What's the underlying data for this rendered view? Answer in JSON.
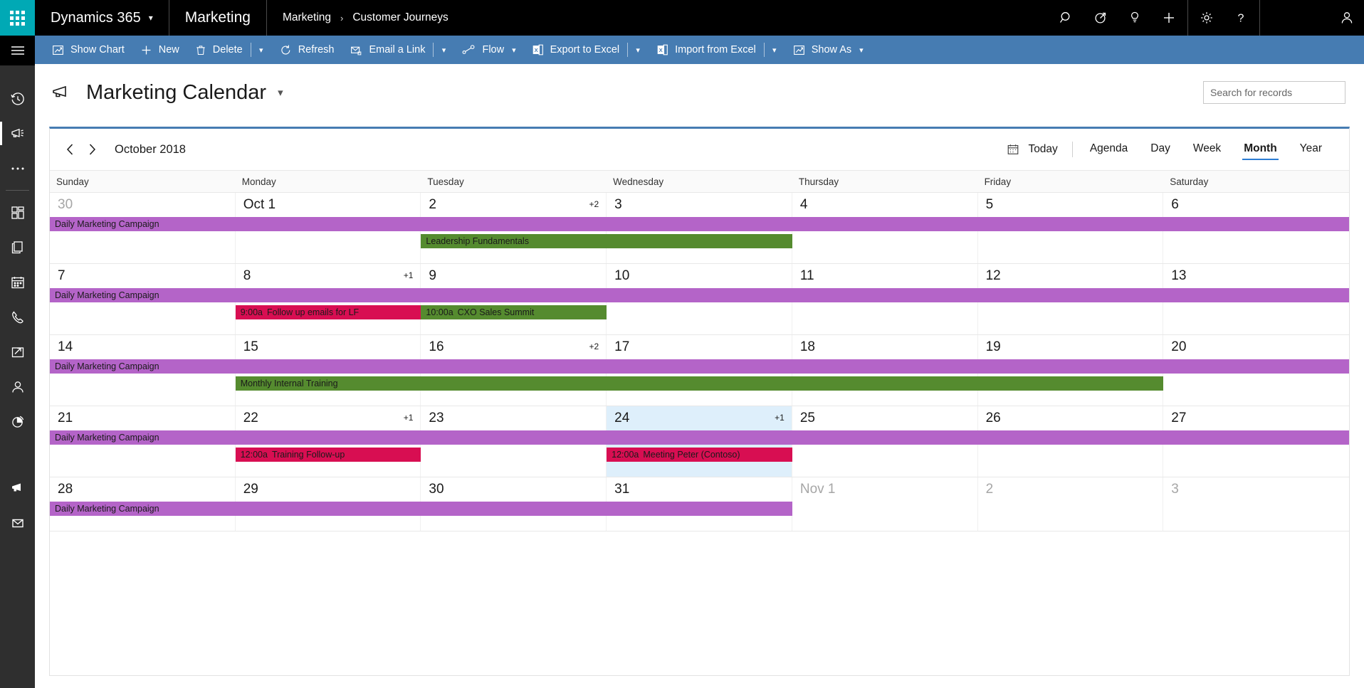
{
  "topbar": {
    "waffle_label": "app-launcher",
    "brand": "Dynamics 365",
    "app_name": "Marketing",
    "breadcrumb": {
      "parent": "Marketing",
      "separator": "›",
      "current": "Customer Journeys"
    },
    "icons": [
      "search-icon",
      "assistant-icon",
      "insights-icon",
      "quick-create-icon",
      "settings-icon",
      "help-icon",
      "user-avatar-icon"
    ]
  },
  "commandbar": {
    "items": [
      {
        "label": "Show Chart",
        "icon": "show-chart-icon",
        "caret": false
      },
      {
        "label": "New",
        "icon": "plus-icon",
        "caret": false
      },
      {
        "label": "Delete",
        "icon": "trash-icon",
        "caret": true,
        "caret_glyph": "⌄"
      },
      {
        "label": "Refresh",
        "icon": "refresh-icon",
        "caret": false
      },
      {
        "label": "Email a Link",
        "icon": "email-link-icon",
        "caret": true,
        "caret_glyph": "⌄"
      },
      {
        "label": "Flow",
        "icon": "flow-icon",
        "caret": true,
        "inline_caret": true,
        "caret_glyph": "⌄"
      },
      {
        "label": "Export to Excel",
        "icon": "excel-export-icon",
        "caret": true,
        "caret_glyph": "⌄"
      },
      {
        "label": "Import from Excel",
        "icon": "excel-import-icon",
        "caret": true,
        "caret_glyph": "⌄"
      },
      {
        "label": "Show As",
        "icon": "show-as-icon",
        "caret": true,
        "inline_caret": true,
        "caret_glyph": "⌄"
      }
    ]
  },
  "pageheader": {
    "icon": "megaphone-icon",
    "title": "Marketing Calendar",
    "chevron": "⌄",
    "search": {
      "placeholder": "Search for records",
      "value": "",
      "icon": "search-icon"
    }
  },
  "leftrail": {
    "items": [
      {
        "name": "menu-toggle",
        "icon": "hamburger-icon",
        "active": false
      },
      {
        "name": "recent-items",
        "icon": "recent-clock-icon",
        "active": false
      },
      {
        "name": "pinned-marketing",
        "icon": "megaphone-icon",
        "active": true
      },
      {
        "name": "more-options",
        "icon": "ellipsis-icon",
        "active": false
      },
      {
        "name": "dashboards",
        "icon": "dashboard-icon",
        "active": false
      },
      {
        "name": "documents",
        "icon": "documents-icon",
        "active": false
      },
      {
        "name": "calendar",
        "icon": "calendar-icon",
        "active": false
      },
      {
        "name": "phone-calls",
        "icon": "phone-icon",
        "active": false
      },
      {
        "name": "cases",
        "icon": "case-folder-icon",
        "active": false
      },
      {
        "name": "contacts",
        "icon": "person-icon",
        "active": false
      },
      {
        "name": "analytics",
        "icon": "pie-chart-icon",
        "active": false
      },
      {
        "name": "campaigns",
        "icon": "megaphone-icon",
        "active": false
      },
      {
        "name": "email-messages",
        "icon": "envelope-icon",
        "active": false
      }
    ]
  },
  "calendar": {
    "prev_label": "‹",
    "next_label": "›",
    "month_label": "October 2018",
    "today_button": {
      "label": "Today",
      "icon": "calendar-icon"
    },
    "views": [
      {
        "label": "Agenda",
        "selected": false
      },
      {
        "label": "Day",
        "selected": false
      },
      {
        "label": "Week",
        "selected": false
      },
      {
        "label": "Month",
        "selected": true
      },
      {
        "label": "Year",
        "selected": false
      }
    ],
    "daynames": [
      "Sunday",
      "Monday",
      "Tuesday",
      "Wednesday",
      "Thursday",
      "Friday",
      "Saturday"
    ],
    "accent_color": "#467cb2",
    "today_cell_color": "#deeffb",
    "event_colors": {
      "purple": "#b464c8",
      "green": "#558b2f",
      "pink": "#d80e52"
    },
    "weeks": [
      {
        "days": [
          {
            "num": "30",
            "other_month": true,
            "today": false,
            "more": ""
          },
          {
            "num": "Oct 1",
            "other_month": false,
            "today": false,
            "more": ""
          },
          {
            "num": "2",
            "other_month": false,
            "today": false,
            "more": "+2"
          },
          {
            "num": "3",
            "other_month": false,
            "today": false,
            "more": ""
          },
          {
            "num": "4",
            "other_month": false,
            "today": false,
            "more": ""
          },
          {
            "num": "5",
            "other_month": false,
            "today": false,
            "more": ""
          },
          {
            "num": "6",
            "other_month": false,
            "today": false,
            "more": ""
          }
        ],
        "lanes": [
          [
            {
              "title": "Daily Marketing Campaign",
              "time": "",
              "color": "purple",
              "start": 0,
              "span": 7
            }
          ],
          [
            {
              "title": "Leadership Fundamentals",
              "time": "",
              "color": "green",
              "start": 2,
              "span": 2
            }
          ]
        ]
      },
      {
        "days": [
          {
            "num": "7",
            "other_month": false,
            "today": false,
            "more": ""
          },
          {
            "num": "8",
            "other_month": false,
            "today": false,
            "more": "+1"
          },
          {
            "num": "9",
            "other_month": false,
            "today": false,
            "more": ""
          },
          {
            "num": "10",
            "other_month": false,
            "today": false,
            "more": ""
          },
          {
            "num": "11",
            "other_month": false,
            "today": false,
            "more": ""
          },
          {
            "num": "12",
            "other_month": false,
            "today": false,
            "more": ""
          },
          {
            "num": "13",
            "other_month": false,
            "today": false,
            "more": ""
          }
        ],
        "lanes": [
          [
            {
              "title": "Daily Marketing Campaign",
              "time": "",
              "color": "purple",
              "start": 0,
              "span": 7
            }
          ],
          [
            {
              "title": "Follow up emails for LF",
              "time": "9:00a",
              "color": "pink",
              "start": 1,
              "span": 1
            },
            {
              "title": "CXO Sales Summit",
              "time": "10:00a",
              "color": "green",
              "start": 2,
              "span": 1
            }
          ]
        ]
      },
      {
        "days": [
          {
            "num": "14",
            "other_month": false,
            "today": false,
            "more": ""
          },
          {
            "num": "15",
            "other_month": false,
            "today": false,
            "more": ""
          },
          {
            "num": "16",
            "other_month": false,
            "today": false,
            "more": "+2"
          },
          {
            "num": "17",
            "other_month": false,
            "today": false,
            "more": ""
          },
          {
            "num": "18",
            "other_month": false,
            "today": false,
            "more": ""
          },
          {
            "num": "19",
            "other_month": false,
            "today": false,
            "more": ""
          },
          {
            "num": "20",
            "other_month": false,
            "today": false,
            "more": ""
          }
        ],
        "lanes": [
          [
            {
              "title": "Daily Marketing Campaign",
              "time": "",
              "color": "purple",
              "start": 0,
              "span": 7
            }
          ],
          [
            {
              "title": "Monthly Internal Training",
              "time": "",
              "color": "green",
              "start": 1,
              "span": 5
            }
          ]
        ]
      },
      {
        "days": [
          {
            "num": "21",
            "other_month": false,
            "today": false,
            "more": ""
          },
          {
            "num": "22",
            "other_month": false,
            "today": false,
            "more": "+1"
          },
          {
            "num": "23",
            "other_month": false,
            "today": false,
            "more": ""
          },
          {
            "num": "24",
            "other_month": false,
            "today": true,
            "more": "+1"
          },
          {
            "num": "25",
            "other_month": false,
            "today": false,
            "more": ""
          },
          {
            "num": "26",
            "other_month": false,
            "today": false,
            "more": ""
          },
          {
            "num": "27",
            "other_month": false,
            "today": false,
            "more": ""
          }
        ],
        "lanes": [
          [
            {
              "title": "Daily Marketing Campaign",
              "time": "",
              "color": "purple",
              "start": 0,
              "span": 7
            }
          ],
          [
            {
              "title": "Training Follow-up",
              "time": "12:00a",
              "color": "pink",
              "start": 1,
              "span": 1
            },
            {
              "title": "Meeting Peter (Contoso)",
              "time": "12:00a",
              "color": "pink",
              "start": 3,
              "span": 1
            }
          ]
        ]
      },
      {
        "days": [
          {
            "num": "28",
            "other_month": false,
            "today": false,
            "more": ""
          },
          {
            "num": "29",
            "other_month": false,
            "today": false,
            "more": ""
          },
          {
            "num": "30",
            "other_month": false,
            "today": false,
            "more": ""
          },
          {
            "num": "31",
            "other_month": false,
            "today": false,
            "more": ""
          },
          {
            "num": "Nov 1",
            "other_month": true,
            "today": false,
            "more": ""
          },
          {
            "num": "2",
            "other_month": true,
            "today": false,
            "more": ""
          },
          {
            "num": "3",
            "other_month": true,
            "today": false,
            "more": ""
          }
        ],
        "lanes": [
          [
            {
              "title": "Daily Marketing Campaign",
              "time": "",
              "color": "purple",
              "start": 0,
              "span": 4
            }
          ]
        ]
      }
    ]
  }
}
